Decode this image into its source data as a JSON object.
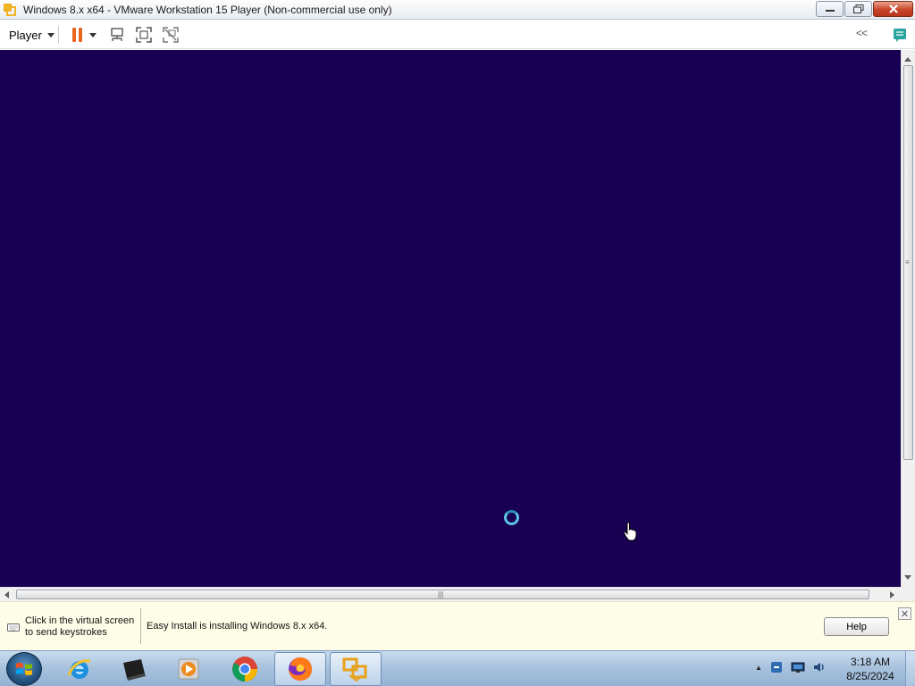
{
  "window": {
    "title": "Windows 8.x x64 - VMware Workstation 15 Player (Non-commercial use only)",
    "icon": "vmware-icon"
  },
  "toolbar": {
    "player_label": "Player",
    "collapse_label": "<<"
  },
  "info_bar": {
    "hint_line1": "Click in the virtual screen",
    "hint_line2": "to send keystrokes",
    "status": "Easy Install is installing Windows 8.x x64.",
    "help_label": "Help"
  },
  "taskbar": {
    "apps": [
      "internet-explorer",
      "vmware-player-manager",
      "media-player",
      "chrome",
      "firefox",
      "vmware-player"
    ],
    "clock_time": "3:18 AM",
    "clock_date": "8/25/2024"
  },
  "colors": {
    "vm_background": "#180052",
    "pause_accent": "#e8651f",
    "infobar_bg": "#fefee8"
  }
}
